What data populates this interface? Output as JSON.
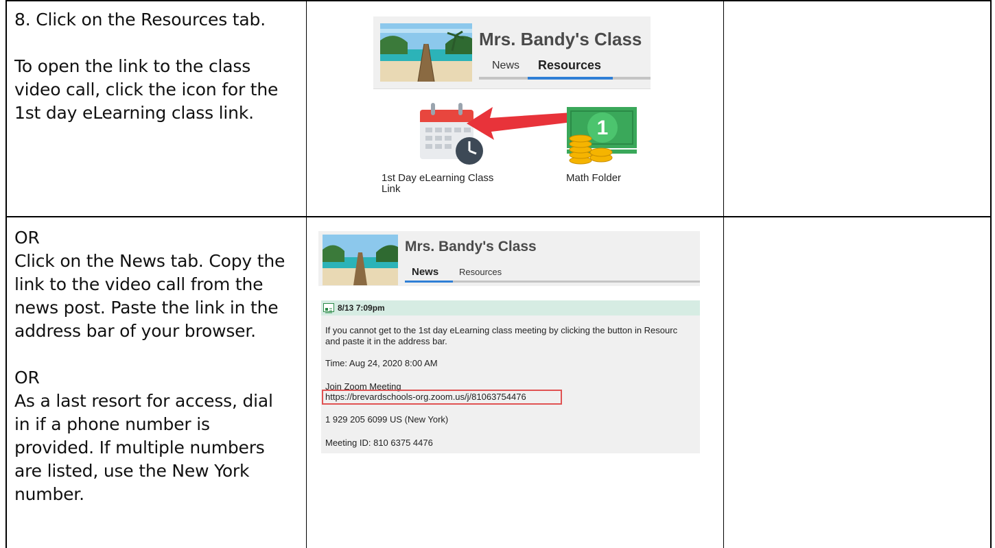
{
  "rows": [
    {
      "instructions": [
        "8. Click on the Resources tab.",
        "",
        "To open the link to the class",
        "video call, click the icon for the",
        "1st day eLearning class link."
      ],
      "screenshot": {
        "class_name": "Mrs. Bandy's Class",
        "tabs": [
          "News",
          "Resources"
        ],
        "active_tab": "Resources",
        "resources": [
          {
            "label": "1st Day eLearning Class Link",
            "icon": "calendar-clock-icon"
          },
          {
            "label": "Math Folder",
            "icon": "money-coins-icon"
          }
        ],
        "arrow_color": "#e8333a"
      }
    },
    {
      "instructions_a": [
        "OR",
        "Click on the News tab. Copy the",
        "link to the video call from the",
        "news post. Paste the link in the",
        "address bar of your browser."
      ],
      "instructions_b": [
        "OR",
        "As a last resort for access, dial",
        "in if a phone number is",
        "provided. If multiple numbers",
        "are listed, use the New York",
        "number."
      ],
      "screenshot": {
        "class_name": "Mrs. Bandy's Class",
        "tabs": [
          "News",
          "Resources"
        ],
        "active_tab": "News",
        "post": {
          "timestamp": "8/13 7:09pm",
          "line1": "If you cannot get to the 1st day eLearning class meeting by clicking the button in Resourc",
          "line2": "and paste it in the address bar.",
          "time": "Time: Aug 24, 2020 8:00 AM",
          "join": "Join Zoom Meeting",
          "link": "https://brevardschools-org.zoom.us/j/81063754476",
          "phone": "1 929 205 6099 US (New York)",
          "meeting_id": "Meeting ID: 810 6375 4476"
        },
        "highlight_color": "#e05252"
      }
    }
  ]
}
